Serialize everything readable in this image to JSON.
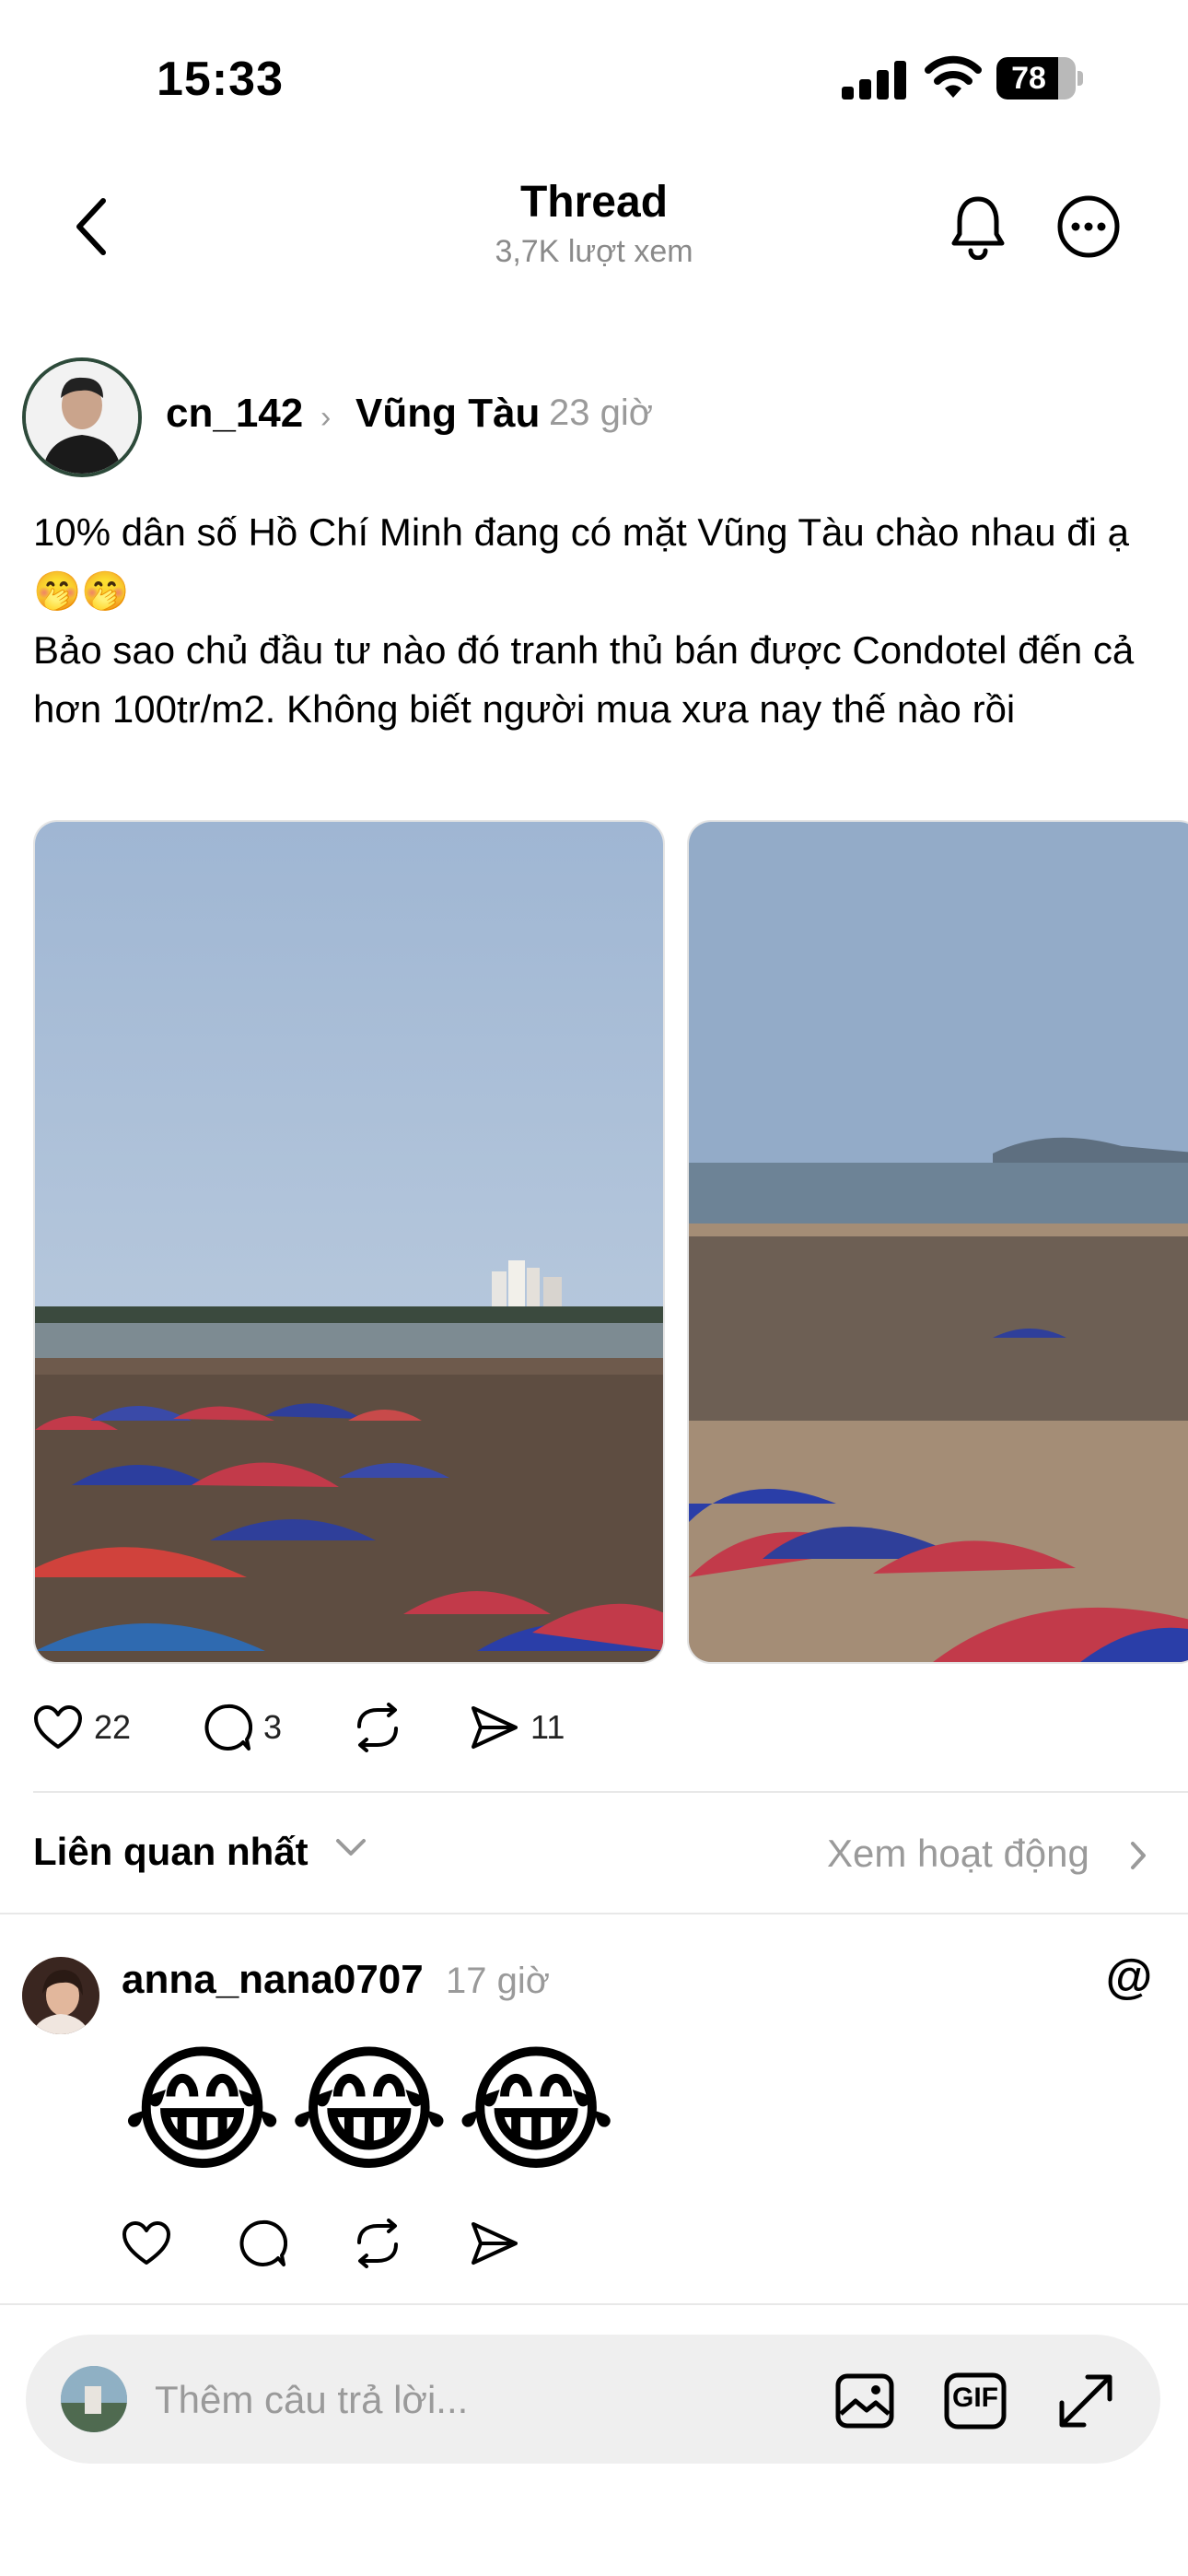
{
  "status": {
    "time": "15:33",
    "battery": "78",
    "battery_level": 0.78
  },
  "header": {
    "title": "Thread",
    "views": "3,7K lượt xem"
  },
  "post": {
    "author": "cn_142",
    "location": "Vũng Tàu",
    "time": "23 giờ",
    "text_lines": [
      "10% dân số Hồ Chí Minh đang có mặt Vũng Tàu chào nhau đi ạ 🤭🤭",
      "Bảo sao chủ đầu tư nào đó tranh thủ bán được Condotel đến cả hơn 100tr/m2. Không biết người mua xưa nay thế nào rồi"
    ],
    "likes": "22",
    "comments": "3",
    "shares": "11"
  },
  "sort": {
    "label": "Liên quan nhất",
    "activity": "Xem hoạt động"
  },
  "comment": {
    "author": "anna_nana0707",
    "time": "17 giờ",
    "text": "😂😂😂"
  },
  "reply": {
    "placeholder": "Thêm câu trả lời...",
    "gif_label": "GIF"
  },
  "colors": {
    "secondary_text": "#9a9a9a",
    "divider": "#e8e8e8",
    "reply_bg": "#efefef"
  },
  "icons": [
    "back-icon",
    "bell-icon",
    "more-icon",
    "heart-icon",
    "comment-icon",
    "repost-icon",
    "share-icon",
    "threads-icon",
    "image-icon",
    "gif-icon",
    "expand-icon"
  ]
}
